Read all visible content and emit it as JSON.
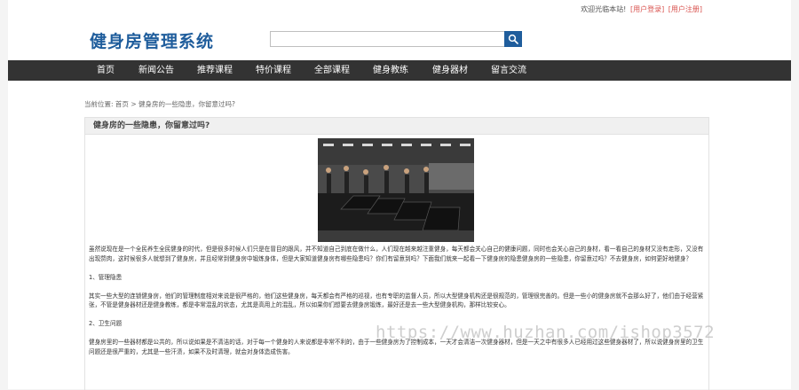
{
  "header": {
    "welcome": "欢迎光临本站!",
    "login": "[用户登录]",
    "register": "[用户注册]",
    "logo": "健身房管理系统",
    "search_placeholder": ""
  },
  "nav": {
    "items": [
      "首页",
      "新闻公告",
      "推荐课程",
      "特价课程",
      "全部课程",
      "健身教练",
      "健身器材",
      "留言交流"
    ]
  },
  "breadcrumb": {
    "prefix": "当前位置:",
    "home": "首页",
    "separator": ">",
    "current": "健身房的一些隐患，你留意过吗?"
  },
  "article": {
    "title": "健身房的一些隐患，你留意过吗?",
    "image_icon": "gym-photo",
    "paragraphs": [
      "虽然说现在是一个全民养生全民健身的时代，但是很多时候人们只是在冒目的跟风，并不知道自己到底在做什么，人们现在越来越注重健身，每天都会关心自己的健康问题，同时也会关心自己的身材，看一看自己的身材又没有走形，又没有出现赘肉，这时候很多人就想到了健身房，并且经常到健身房中锻炼身体，但是大家知道健身房有哪些隐患吗？你们有留意到吗？下面我们就来一起看一下健身房的隐患健身房的一些隐患，你留意过吗？不去健身房，如何更好地健身？",
      "1、管理隐患",
      "其实一些大型的连锁健身房，他们的管理制度相对来说是很严格的，他们这些健身房，每天都会有严格的巡视，也有专职的监督人员，所以大型健身机构还是很规范的，管理很完善的。但是一些小的健身房就不会那么好了，他们由于经营紧张，不管是健身器材还是健身教练，都是非常混乱的状态，尤其是高用上的混乱，所以如果你们想要去健身房锻炼，最好还是去一些大型健身机构，那样比较安心。",
      "2、卫生问题",
      "健身房里的一些器材都是公共的，所以说如果是不清洁的话，对于每一个健身的人来说都是非常不利的，由于一些健身房为了控制成本，一天才会清洁一次健身器材，但是一天之中有很多人已经用过这些健身器材了，所以说健身房里的卫生问题还是很严重的，尤其是一些汗渍，如果不及时清理，就会对身体造成伤害。"
    ]
  },
  "watermark": "https://www.huzhan.com/ishop3572",
  "colors": {
    "brand_blue": "#1f5d9c",
    "nav_bg": "#333333",
    "link_red": "#d9534f"
  }
}
